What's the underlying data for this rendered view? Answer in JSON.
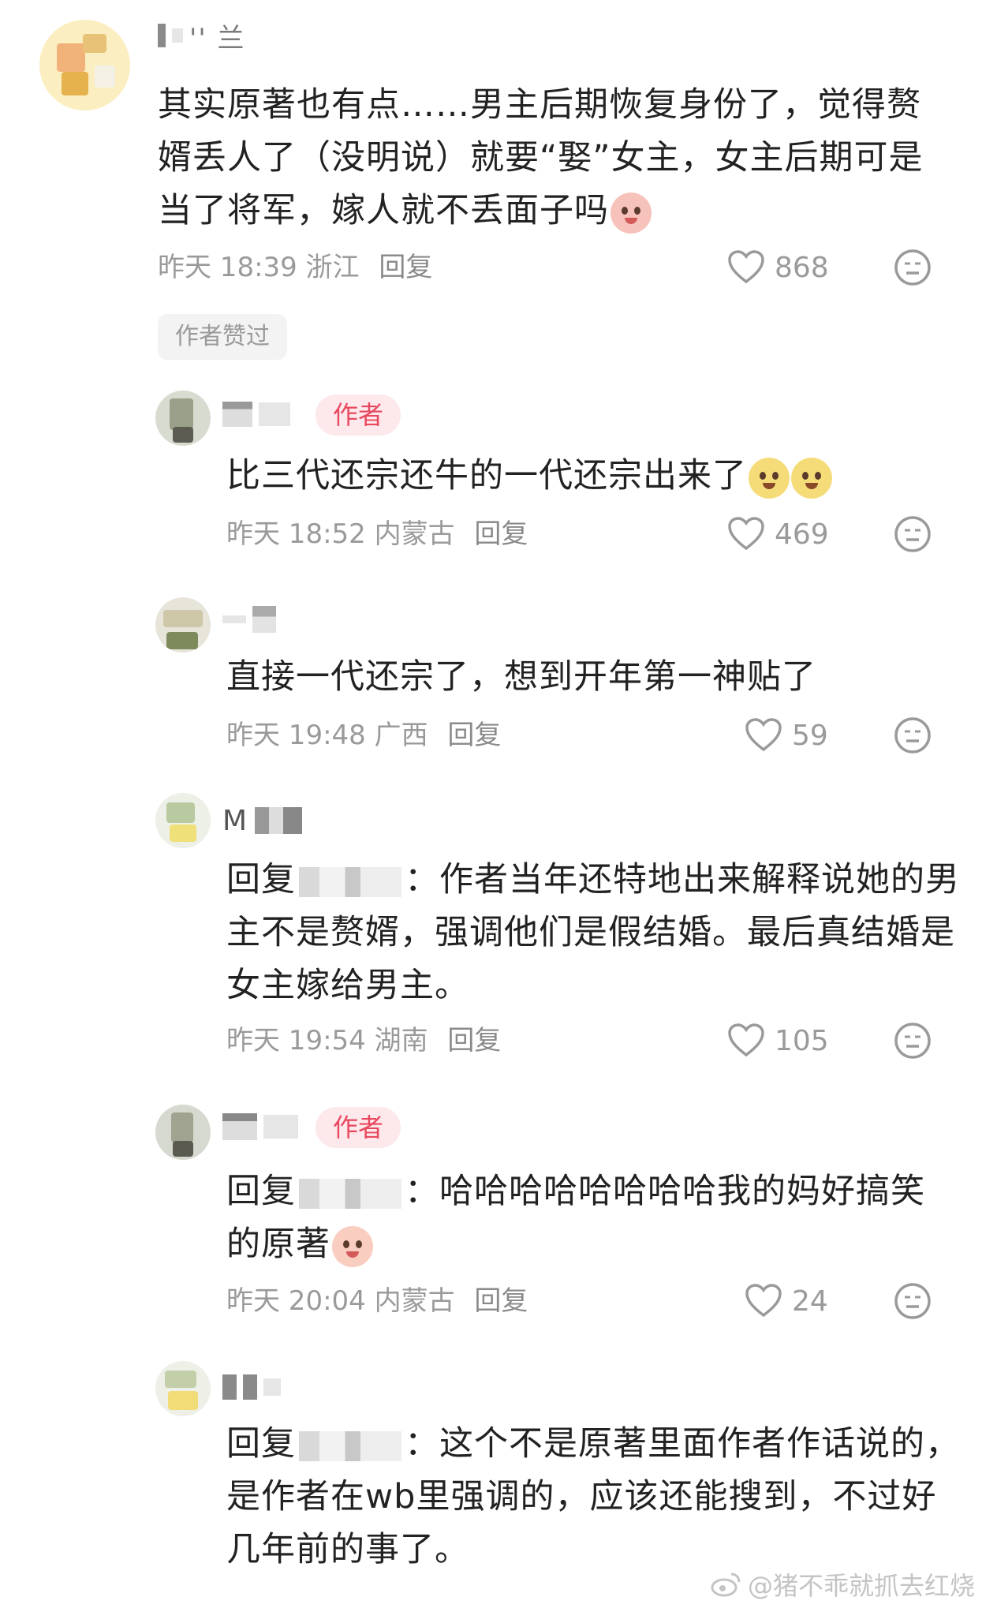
{
  "comments": [
    {
      "username": "'' 兰",
      "text": "其实原著也有点……男主后期恢复身份了，觉得赘婿丢人了（没明说）就要“娶”女主，女主后期可是当了将军，嫁人就不丢面子吗",
      "time": "昨天 18:39",
      "location": "浙江",
      "reply_label": "回复",
      "likes": "868",
      "liked_tag": "作者赞过"
    },
    {
      "is_author": true,
      "author_badge": "作者",
      "text": "比三代还宗还牛的一代还宗出来了",
      "time": "昨天 18:52",
      "location": "内蒙古",
      "reply_label": "回复",
      "likes": "469"
    },
    {
      "text": "直接一代还宗了，想到开年第一神贴了",
      "time": "昨天 19:48",
      "location": "广西",
      "reply_label": "回复",
      "likes": "59"
    },
    {
      "username": "M",
      "reply_prefix": "回复",
      "text": "：作者当年还特地出来解释说她的男主不是赘婿，强调他们是假结婚。最后真结婚是女主嫁给男主。",
      "time": "昨天 19:54",
      "location": "湖南",
      "reply_label": "回复",
      "likes": "105"
    },
    {
      "is_author": true,
      "author_badge": "作者",
      "reply_prefix": "回复",
      "text": "：哈哈哈哈哈哈哈哈我的妈好搞笑的原著",
      "time": "昨天 20:04",
      "location": "内蒙古",
      "reply_label": "回复",
      "likes": "24"
    },
    {
      "reply_prefix": "回复",
      "text": "：这个不是原著里面作者作话说的，是作者在wb里强调的，应该还能搜到，不过好几年前的事了。"
    }
  ],
  "watermark": "@猪不乖就抓去红烧",
  "icons": {
    "like": "heart-outline-icon",
    "mood": "neutral-face-icon",
    "weibo": "weibo-logo-icon"
  },
  "colors": {
    "author_badge_bg": "#fde8eb",
    "author_badge_text": "#e8485f",
    "meta_text": "#9a9a9a"
  }
}
